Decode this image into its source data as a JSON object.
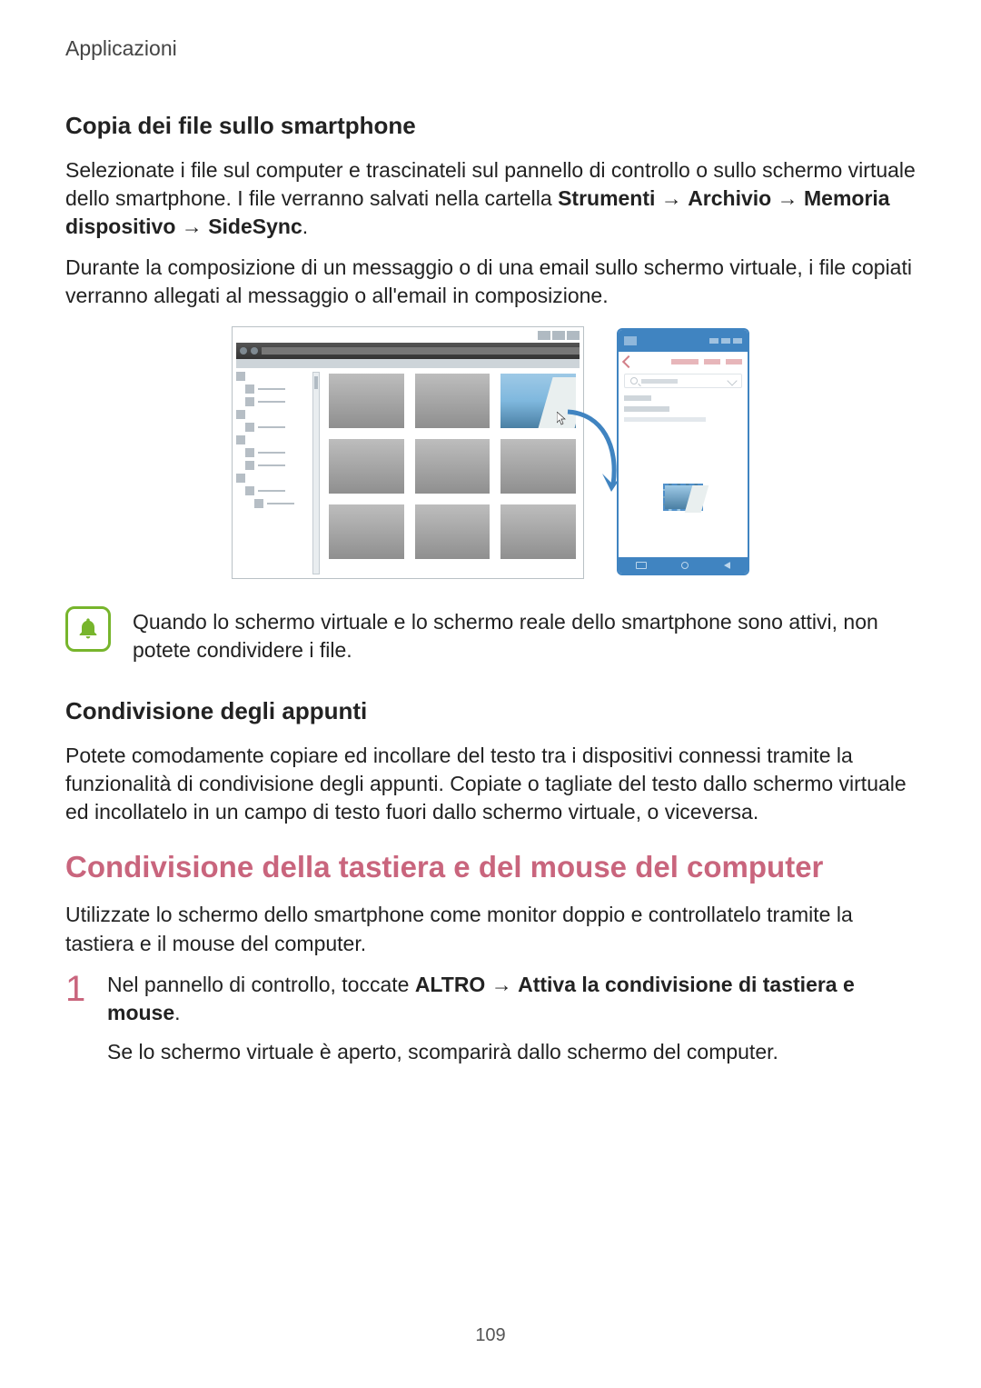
{
  "header": {
    "section": "Applicazioni"
  },
  "section1": {
    "heading": "Copia dei file sullo smartphone",
    "p1_a": "Selezionate i file sul computer e trascinateli sul pannello di controllo o sullo schermo virtuale dello smartphone. I file verranno salvati nella cartella ",
    "p1_b1": "Strumenti",
    "p1_b2": "Archivio",
    "p1_b3": "Memoria dispositivo",
    "p1_b4": "SideSync",
    "p1_arrow": " → ",
    "p1_dot": ".",
    "p2": "Durante la composizione di un messaggio o di una email sullo schermo virtuale, i file copiati verranno allegati al messaggio o all'email in composizione."
  },
  "note": {
    "text": "Quando lo schermo virtuale e lo schermo reale dello smartphone sono attivi, non potete condividere i file."
  },
  "section2": {
    "heading": "Condivisione degli appunti",
    "p1": "Potete comodamente copiare ed incollare del testo tra i dispositivi connessi tramite la funzionalità di condivisione degli appunti. Copiate o tagliate del testo dallo schermo virtuale ed incollatelo in un campo di testo fuori dallo schermo virtuale, o viceversa."
  },
  "section3": {
    "heading": "Condivisione della tastiera e del mouse del computer",
    "p1": "Utilizzate lo schermo dello smartphone come monitor doppio e controllatelo tramite la tastiera e il mouse del computer."
  },
  "step1": {
    "num": "1",
    "a": "Nel pannello di controllo, toccate ",
    "b1": "ALTRO",
    "arrow": " → ",
    "b2": "Attiva la condivisione di tastiera e mouse",
    "dot": ".",
    "p2": "Se lo schermo virtuale è aperto, scomparirà dallo schermo del computer."
  },
  "pagenum": "109"
}
